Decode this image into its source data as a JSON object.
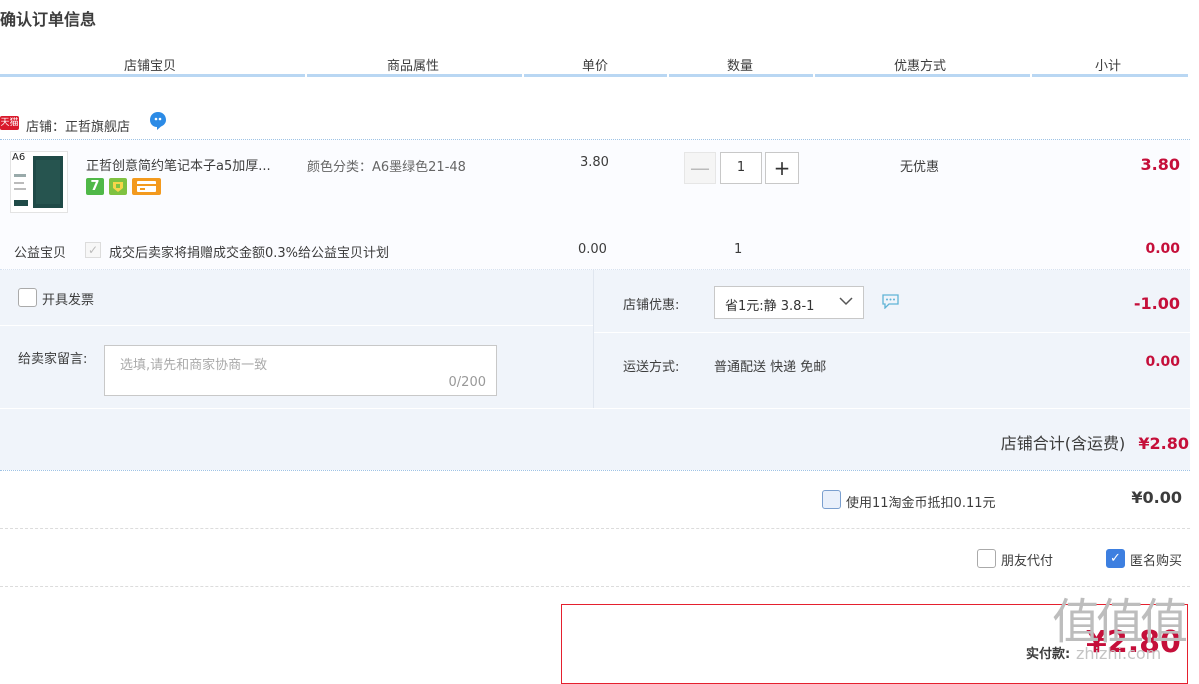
{
  "page": {
    "title": "确认订单信息"
  },
  "columns": {
    "item": "店铺宝贝",
    "attributes": "商品属性",
    "unit_price": "单价",
    "quantity": "数量",
    "discount": "优惠方式",
    "subtotal": "小计"
  },
  "shop": {
    "badge": "天猫",
    "label": "店铺：正哲旗舰店"
  },
  "item": {
    "thumb_tag": "A6",
    "title": "正哲创意简约笔记本子a5加厚...",
    "service_badge_1": "7",
    "attribute": "颜色分类：A6墨绿色21-48",
    "unit_price": "3.80",
    "quantity": "1",
    "minus": "—",
    "plus": "+",
    "discount": "无优惠",
    "subtotal": "3.80"
  },
  "charity": {
    "label": "公益宝贝",
    "text": "成交后卖家将捐赠成交金额0.3%给公益宝贝计划",
    "price": "0.00",
    "quantity": "1",
    "subtotal": "0.00"
  },
  "options": {
    "invoice_label": "开具发票",
    "message_label": "给卖家留言:",
    "message_placeholder": "选填,请先和商家协商一致",
    "message_count": "0/200",
    "shop_discount_label": "店铺优惠:",
    "shop_discount_value": "省1元:静 3.8-1",
    "shop_discount_amount": "-1.00",
    "shipping_label": "运送方式:",
    "shipping_value": "普通配送 快递 免邮",
    "shipping_amount": "0.00"
  },
  "total": {
    "label": "店铺合计(含运费)",
    "amount": "¥2.80"
  },
  "coins": {
    "label": "使用11淘金币抵扣0.11元",
    "amount": "¥0.00"
  },
  "checks": {
    "friend_pay": "朋友代付",
    "anonymous": "匿名购买"
  },
  "payment": {
    "label": "实付款:",
    "amount": "¥2.80"
  },
  "watermark": {
    "logo": "值值值",
    "url": "zhizhi.com"
  },
  "colors": {
    "accent_red": "#c50f3a",
    "header_line": "#b9d7f3",
    "option_bg": "#f0f4fa",
    "checkbox_blue": "#3d7fe0",
    "pay_border": "#e5202e"
  }
}
